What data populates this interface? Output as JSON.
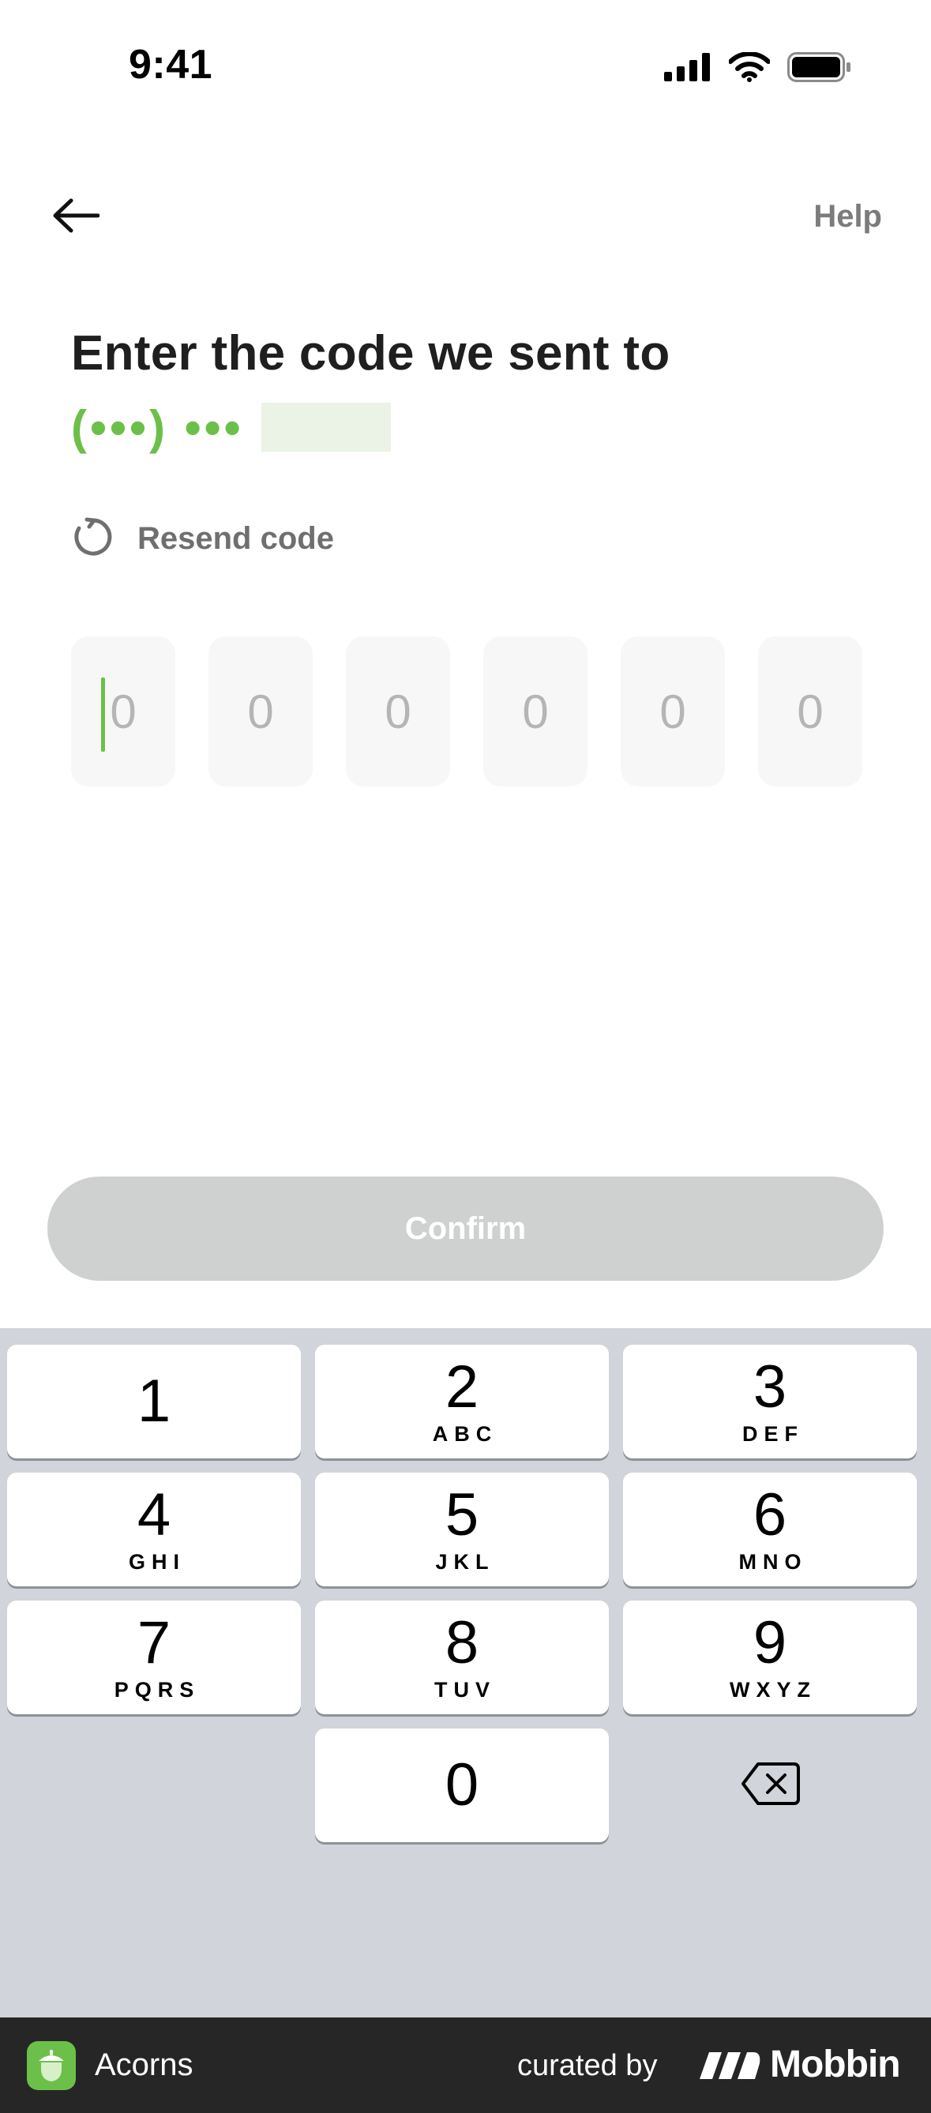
{
  "status_bar": {
    "time": "9:41",
    "icons": [
      "cellular-signal-icon",
      "wifi-icon",
      "battery-icon"
    ]
  },
  "nav": {
    "back_icon": "arrow-left-icon",
    "help_label": "Help"
  },
  "header": {
    "title": "Enter the code we sent to",
    "phone_masked": "(•••) •••"
  },
  "resend": {
    "icon": "refresh-icon",
    "label": "Resend code"
  },
  "code_inputs": {
    "placeholders": [
      "0",
      "0",
      "0",
      "0",
      "0",
      "0"
    ]
  },
  "confirm": {
    "label": "Confirm"
  },
  "keypad": {
    "keys": [
      {
        "digit": "1",
        "letters": ""
      },
      {
        "digit": "2",
        "letters": "ABC"
      },
      {
        "digit": "3",
        "letters": "DEF"
      },
      {
        "digit": "4",
        "letters": "GHI"
      },
      {
        "digit": "5",
        "letters": "JKL"
      },
      {
        "digit": "6",
        "letters": "MNO"
      },
      {
        "digit": "7",
        "letters": "PQRS"
      },
      {
        "digit": "8",
        "letters": "TUV"
      },
      {
        "digit": "9",
        "letters": "WXYZ"
      },
      {
        "digit": "0",
        "letters": ""
      }
    ],
    "delete_icon": "backspace-icon"
  },
  "footer": {
    "app_name": "Acorns",
    "curated_by": "curated by",
    "brand": "Mobbin"
  },
  "colors": {
    "accent_green": "#6cc04a",
    "button_disabled": "#cfd0d0",
    "keypad_bg": "#d1d4da",
    "footer_bg": "#262626"
  }
}
